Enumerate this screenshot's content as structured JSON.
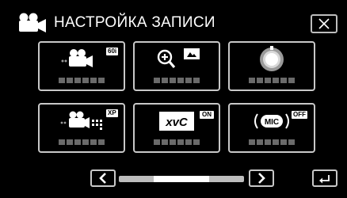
{
  "header": {
    "title": "НАСТРОЙКА ЗАПИСИ",
    "title_icon": "camcorder-icon"
  },
  "close": {
    "icon": "close-icon"
  },
  "tiles": [
    {
      "name": "video-quality",
      "icon": "camcorder-icon",
      "badge": "60i"
    },
    {
      "name": "zoom",
      "icon": "zoom-icon",
      "badge": ""
    },
    {
      "name": "shutter",
      "icon": "dial-icon",
      "badge": ""
    },
    {
      "name": "x-v-color",
      "icon": "camcorder-xp-icon",
      "badge": "XP"
    },
    {
      "name": "xvc",
      "icon": "xvc-icon",
      "badge": "ON",
      "label": "xvC"
    },
    {
      "name": "mic",
      "icon": "mic-icon",
      "badge": "OFF",
      "label": "MIC"
    }
  ],
  "nav": {
    "prev_icon": "chevron-left-icon",
    "next_icon": "chevron-right-icon",
    "back_icon": "return-icon"
  },
  "scroll": {
    "position_fraction": 0.45
  }
}
